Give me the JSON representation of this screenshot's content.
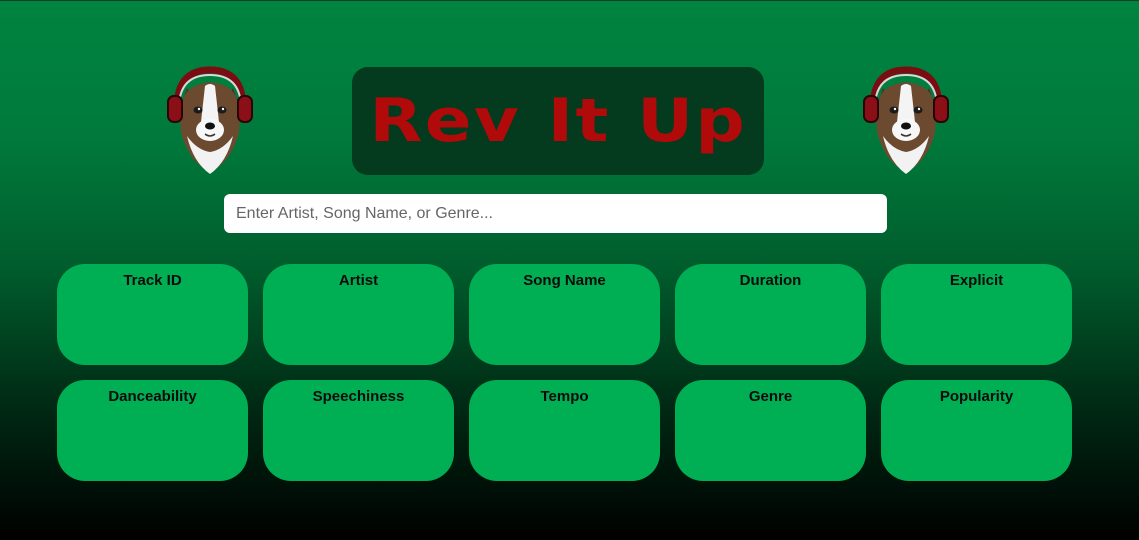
{
  "app": {
    "title": "Rev It Up"
  },
  "search": {
    "placeholder": "Enter Artist, Song Name, or Genre...",
    "value": ""
  },
  "fields": [
    {
      "label": "Track ID"
    },
    {
      "label": "Artist"
    },
    {
      "label": "Song Name"
    },
    {
      "label": "Duration"
    },
    {
      "label": "Explicit"
    },
    {
      "label": "Danceability"
    },
    {
      "label": "Speechiness"
    },
    {
      "label": "Tempo"
    },
    {
      "label": "Genre"
    },
    {
      "label": "Popularity"
    }
  ],
  "logos": {
    "icon": "dog-with-headphones-icon"
  },
  "colors": {
    "title_text": "#b00a0a",
    "title_box": "#043a1d",
    "card": "#00ae54",
    "gradient_top": "#00843f",
    "gradient_bottom": "#000000"
  }
}
